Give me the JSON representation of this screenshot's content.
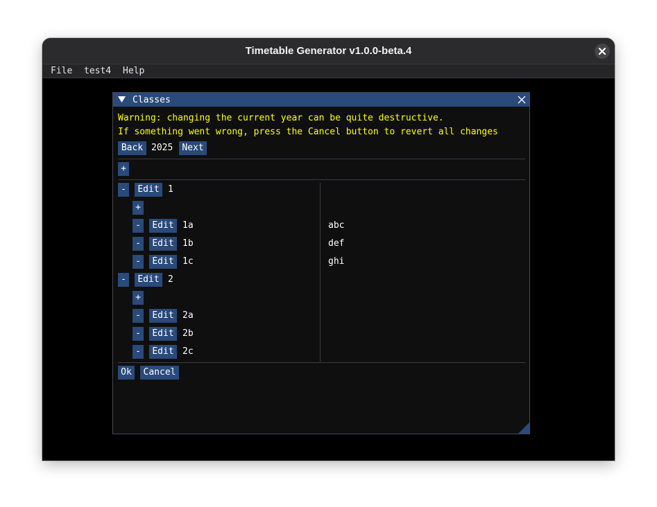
{
  "window": {
    "title": "Timetable Generator v1.0.0-beta.4",
    "close_icon": "close-icon"
  },
  "menubar": {
    "items": [
      "File",
      "test4",
      "Help"
    ]
  },
  "dialog": {
    "title": "Classes",
    "warning_lines": [
      "Warning: changing the current year can be quite destructive.",
      "If something went wrong, press the Cancel button to revert all changes"
    ],
    "year_nav": {
      "back": "Back",
      "year": "2025",
      "next": "Next"
    },
    "add_label": "+",
    "remove_label": "-",
    "edit_label": "Edit",
    "groups": [
      {
        "name": "1",
        "classes": [
          {
            "name": "1a",
            "detail": "abc"
          },
          {
            "name": "1b",
            "detail": "def"
          },
          {
            "name": "1c",
            "detail": "ghi"
          }
        ]
      },
      {
        "name": "2",
        "classes": [
          {
            "name": "2a",
            "detail": ""
          },
          {
            "name": "2b",
            "detail": ""
          },
          {
            "name": "2c",
            "detail": ""
          }
        ]
      }
    ],
    "footer": {
      "ok": "Ok",
      "cancel": "Cancel"
    }
  },
  "colors": {
    "accent": "#294a7a",
    "warning_text": "#ffff00",
    "dialog_bg": "#0f0f10"
  }
}
